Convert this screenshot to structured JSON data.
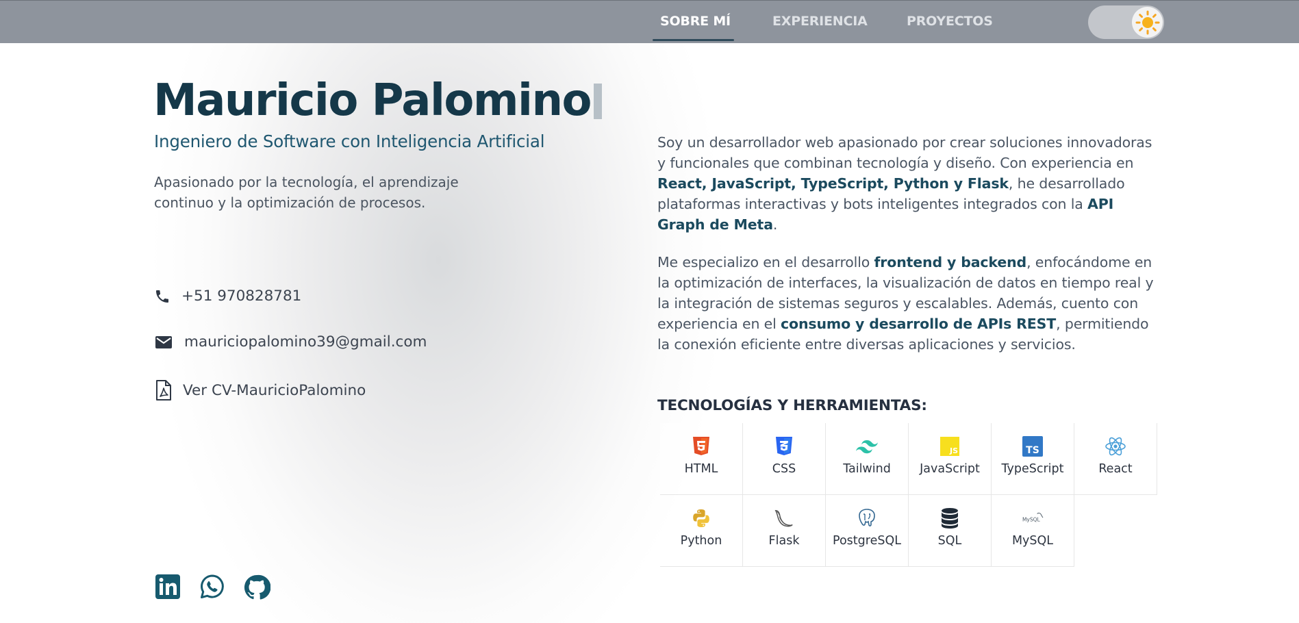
{
  "nav": {
    "tabs": [
      {
        "label": "SOBRE MÍ"
      },
      {
        "label": "EXPERIENCIA"
      },
      {
        "label": "PROYECTOS"
      }
    ],
    "theme_toggle_icon": "sun-icon"
  },
  "hero": {
    "name": "Mauricio Palomino",
    "subtitle": "Ingeniero de Software con Inteligencia Artificial",
    "tagline": "Apasionado por la tecnología, el aprendizaje continuo y la optimización de procesos."
  },
  "contacts": {
    "phone": "+51 970828781",
    "email": "mauriciopalomino39@gmail.com",
    "cv": "Ver CV-MauricioPalomino"
  },
  "social": {
    "items": [
      {
        "icon": "linkedin-icon"
      },
      {
        "icon": "whatsapp-icon"
      },
      {
        "icon": "github-icon"
      }
    ]
  },
  "about": {
    "p1": {
      "t1": "Soy un desarrollador web apasionado por crear soluciones innovadoras y funcionales que combinan tecnología y diseño. Con experiencia en ",
      "b1": "React, JavaScript, TypeScript, Python y Flask",
      "t2": ", he desarrollado plataformas interactivas y bots inteligentes integrados con la ",
      "b2": "API Graph de Meta",
      "t3": "."
    },
    "p2": {
      "t1": "Me especializo en el desarrollo ",
      "b1": "frontend y backend",
      "t2": ", enfocándome en la optimización de interfaces, la visualización de datos en tiempo real y la integración de sistemas seguros y escalables. Además, cuento con experiencia en el ",
      "b2": "consumo y desarrollo de APIs REST",
      "t3": ", permitiendo la conexión eficiente entre diversas aplicaciones y servicios."
    }
  },
  "tech": {
    "title": "TECNOLOGÍAS Y HERRAMIENTAS:",
    "items": [
      {
        "label": "HTML",
        "icon": "html5-icon",
        "color": "#e44d26"
      },
      {
        "label": "CSS",
        "icon": "css3-icon",
        "color": "#2965f1"
      },
      {
        "label": "Tailwind",
        "icon": "tailwind-icon",
        "color": "#38bdf8"
      },
      {
        "label": "JavaScript",
        "icon": "javascript-icon",
        "color": "#f7df1e"
      },
      {
        "label": "TypeScript",
        "icon": "typescript-icon",
        "color": "#3178c6"
      },
      {
        "label": "React",
        "icon": "react-icon",
        "color": "#61dafb"
      },
      {
        "label": "Python",
        "icon": "python-icon",
        "color": "#e8b32a"
      },
      {
        "label": "Flask",
        "icon": "flask-icon",
        "color": "#555555"
      },
      {
        "label": "PostgreSQL",
        "icon": "postgresql-icon",
        "color": "#336791"
      },
      {
        "label": "SQL",
        "icon": "database-icon",
        "color": "#1f2a36"
      },
      {
        "label": "MySQL",
        "icon": "mysql-icon",
        "color": "#555555"
      }
    ]
  }
}
